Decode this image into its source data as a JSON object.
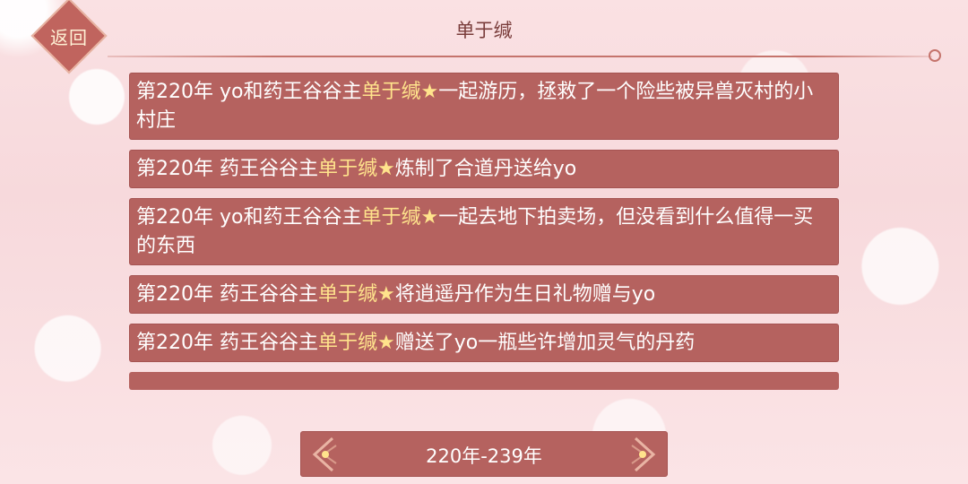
{
  "header": {
    "back_label": "返回",
    "title": "单于缄"
  },
  "entries": [
    {
      "prefix": "第220年 yo和药王谷谷主",
      "name": "单于缄★",
      "suffix": "一起游历，拯救了一个险些被异兽灭村的小村庄"
    },
    {
      "prefix": "第220年 药王谷谷主",
      "name": "单于缄★",
      "suffix": "炼制了合道丹送给yo"
    },
    {
      "prefix": "第220年 yo和药王谷谷主",
      "name": "单于缄★",
      "suffix": "一起去地下拍卖场，但没看到什么值得一买的东西"
    },
    {
      "prefix": "第220年 药王谷谷主",
      "name": "单于缄★",
      "suffix": "将逍遥丹作为生日礼物赠与yo"
    },
    {
      "prefix": "第220年 药王谷谷主",
      "name": "单于缄★",
      "suffix": "赠送了yo一瓶些许增加灵气的丹药"
    }
  ],
  "pagination": {
    "range_label": "220年-239年",
    "prev_icon": "chevron-left-icon",
    "next_icon": "chevron-right-icon"
  },
  "colors": {
    "panel": "#b5625f",
    "highlight": "#ffe38c",
    "title_text": "#7a3d3b"
  }
}
